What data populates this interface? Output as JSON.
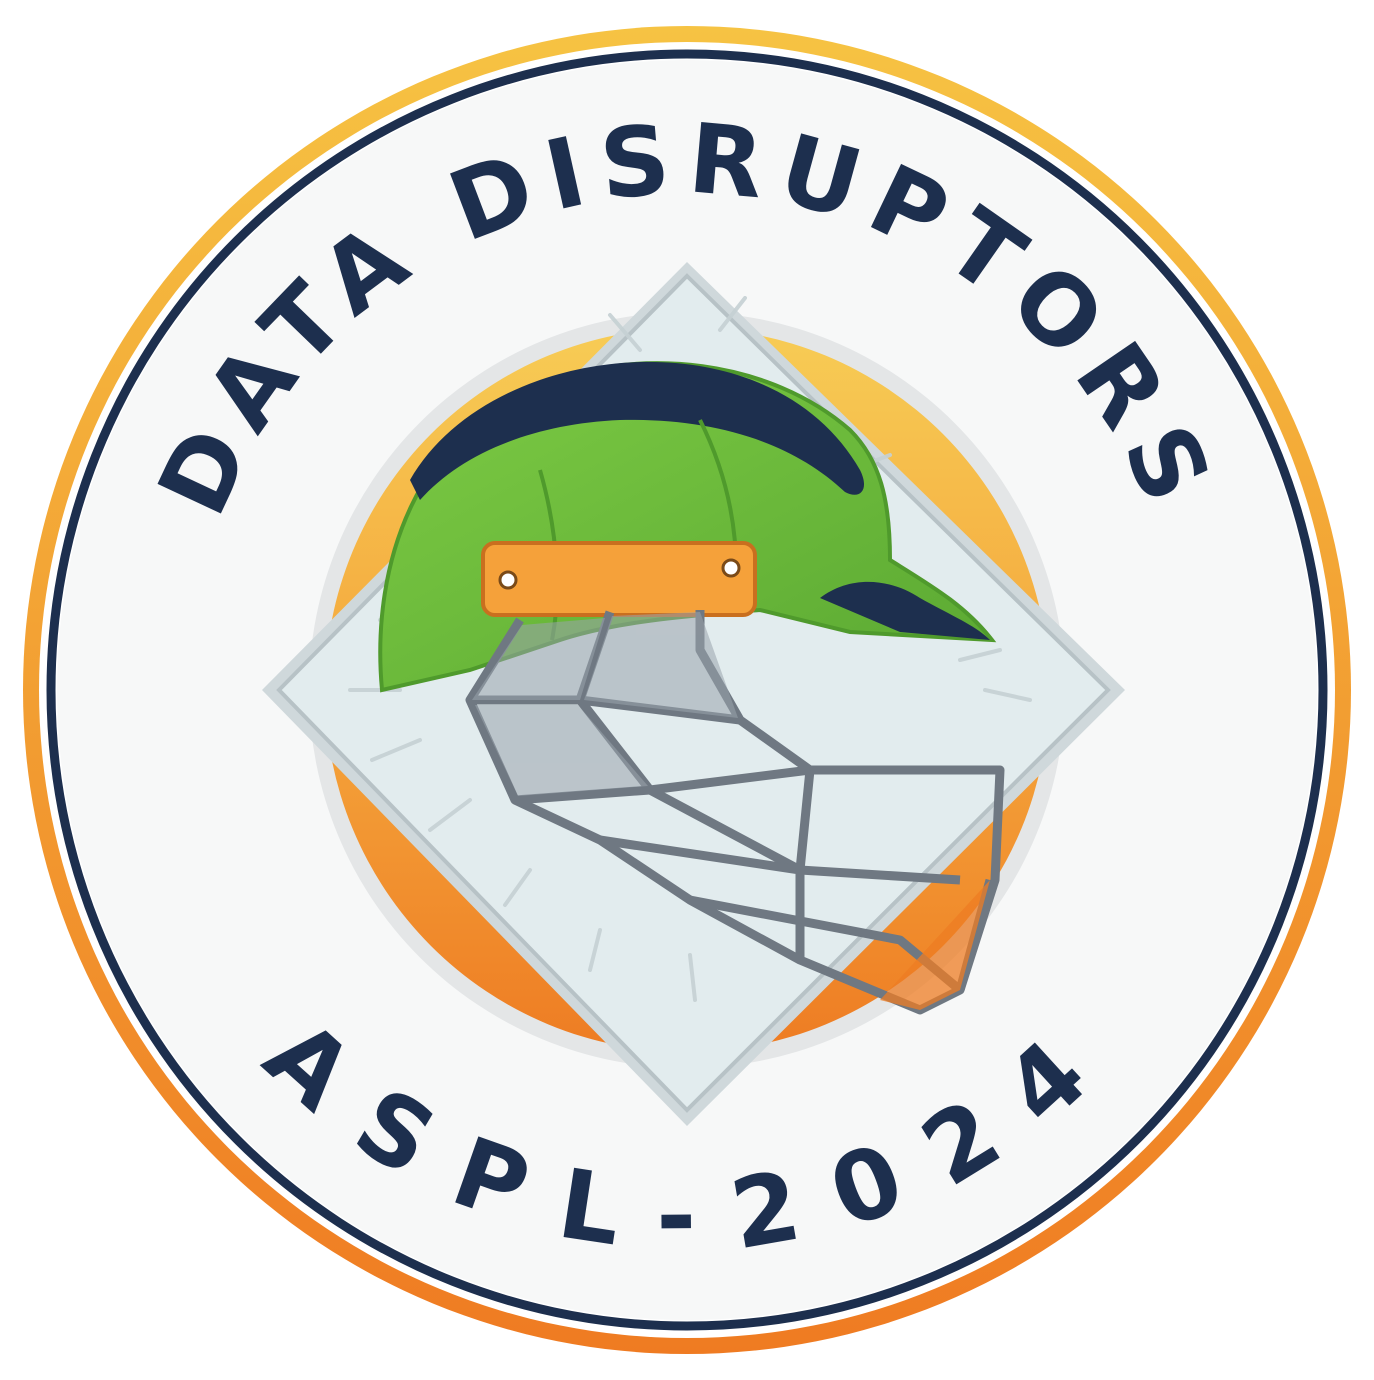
{
  "logo": {
    "top_text": "DATA DISRUPTORS",
    "bottom_text": "ASPL-2024"
  },
  "colors": {
    "page_background": "#ffffff",
    "ring_gold": "#f4b63a",
    "ring_orange": "#f07a22",
    "disc_white": "#f7f8f8",
    "text_navy": "#1d2f4e",
    "orb_yellow": "#f7c64a",
    "orb_orange": "#f0852a",
    "diamond_fill": "#e2ecee",
    "helmet_green": "#6cc13c",
    "helmet_navy": "#1d2f4e",
    "bracket_orange": "#f5a13a",
    "grille_grey": "#7c8590",
    "grille_fill": "#9aa4ad"
  },
  "icons": {
    "emblem": "cricket-helmet-icon"
  }
}
